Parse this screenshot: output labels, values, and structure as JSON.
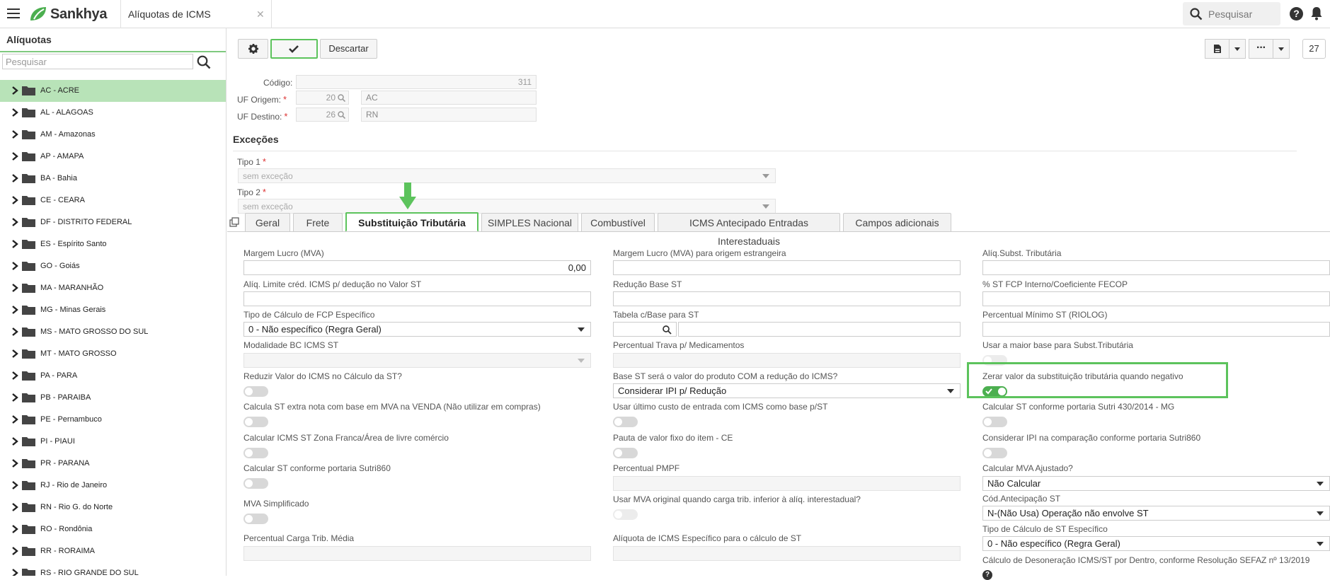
{
  "app": {
    "brand": "Sankhya",
    "tab_title": "Alíquotas de ICMS",
    "search_placeholder": "Pesquisar"
  },
  "sidebar": {
    "title": "Alíquotas",
    "search_placeholder": "Pesquisar",
    "items": [
      "AC - ACRE",
      "AL - ALAGOAS",
      "AM - Amazonas",
      "AP - AMAPA",
      "BA - Bahia",
      "CE - CEARA",
      "DF - DISTRITO FEDERAL",
      "ES - Espírito Santo",
      "GO - Goiás",
      "MA - MARANHÃO",
      "MG - Minas Gerais",
      "MS - MATO GROSSO DO SUL",
      "MT - MATO GROSSO",
      "PA - PARA",
      "PB - PARAIBA",
      "PE - Pernambuco",
      "PI - PIAUI",
      "PR - PARANA",
      "RJ - Rio de Janeiro",
      "RN - Rio G. do Norte",
      "RO - Rondônia",
      "RR - RORAIMA",
      "RS - RIO GRANDE DO SUL"
    ],
    "selected_index": 0
  },
  "toolbar": {
    "discard_label": "Descartar",
    "record_number": "27"
  },
  "header_fields": {
    "codigo_label": "Código:",
    "codigo_value": "311",
    "uf_origem_label": "UF Origem:",
    "uf_origem_code": "20",
    "uf_origem_name": "AC",
    "uf_destino_label": "UF Destino:",
    "uf_destino_code": "26",
    "uf_destino_name": "RN"
  },
  "excecoes": {
    "title": "Exceções",
    "tipo1_label": "Tipo 1",
    "tipo1_value": "sem exceção",
    "tipo2_label": "Tipo 2",
    "tipo2_value": "sem exceção"
  },
  "tabs": [
    "Geral",
    "Frete",
    "Substituição Tributária",
    "SIMPLES Nacional",
    "Combustível",
    "ICMS Antecipado Entradas Interestaduais",
    "Campos adicionais"
  ],
  "active_tab": "Substituição Tributária",
  "form": {
    "col1": {
      "margem_lucro_label": "Margem Lucro (MVA)",
      "margem_lucro_value": "0,00",
      "aliq_limite_label": "Alíq. Limite créd. ICMS p/ dedução no Valor ST",
      "tipo_calc_fcp_label": "Tipo de Cálculo de FCP Específico",
      "tipo_calc_fcp_value": "0 - Não específico (Regra Geral)",
      "modalidade_label": "Modalidade BC ICMS ST",
      "reduzir_label": "Reduzir Valor do ICMS no Cálculo da ST?",
      "calcula_extra_label": "Calcula ST extra nota com base em MVA na VENDA (Não utilizar em compras)",
      "calc_zona_label": "Calcular ICMS ST Zona Franca/Área de livre comércio",
      "calc_sutri_label": "Calcular ST conforme portaria Sutri860",
      "mva_simpl_label": "MVA Simplificado",
      "perc_carga_label": "Percentual Carga Trib. Média"
    },
    "col2": {
      "margem_estr_label": "Margem Lucro (MVA) para origem estrangeira",
      "reducao_label": "Redução Base ST",
      "tabela_label": "Tabela c/Base para ST",
      "perc_trava_label": "Percentual Trava p/ Medicamentos",
      "base_st_label": "Base ST será o valor do produto COM a redução do ICMS?",
      "base_st_value": "Considerar IPI p/ Redução",
      "usar_ultimo_label": "Usar último custo de entrada com ICMS como base p/ST",
      "pauta_label": "Pauta de valor fixo do item - CE",
      "pmpf_label": "Percentual PMPF",
      "usar_mva_label": "Usar MVA original quando carga trib. inferior à alíq. interestadual?",
      "aliq_esp_label": "Alíquota de ICMS Específico para o cálculo de ST"
    },
    "col3": {
      "aliq_subst_label": "Alíq.Subst. Tributária",
      "perc_fcp_label": "% ST FCP Interno/Coeficiente FECOP",
      "perc_min_label": "Percentual Mínimo ST (RIOLOG)",
      "maior_base_label": "Usar a maior base para Subst.Tributária",
      "zerar_label": "Zerar valor da substituição tributária quando negativo",
      "sutri430_label": "Calcular ST conforme portaria Sutri 430/2014 - MG",
      "considerar_ipi_label": "Considerar IPI na comparação conforme portaria Sutri860",
      "calc_mva_label": "Calcular MVA Ajustado?",
      "calc_mva_value": "Não Calcular",
      "cod_antec_label": "Cód.Antecipação ST",
      "cod_antec_value": "N-(Não Usa) Operação não envolve ST",
      "tipo_calc_st_label": "Tipo de Cálculo de ST Específico",
      "tipo_calc_st_value": "0 - Não específico (Regra Geral)",
      "deson_label": "Cálculo de Desoneração ICMS/ST por Dentro, conforme Resolução SEFAZ nº 13/2019"
    }
  },
  "colors": {
    "accent": "#5cc35c",
    "selected_row": "#b8e3b8",
    "toggle_on": "#4caf50"
  }
}
